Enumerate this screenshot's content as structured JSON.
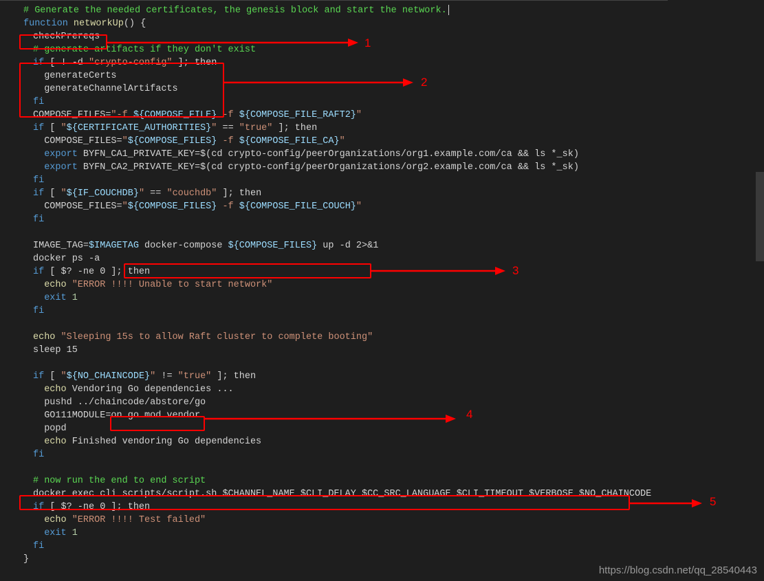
{
  "code": {
    "l1": "# Generate the needed certificates, the genesis block and start the network.",
    "l2_fn": "function",
    "l2_name": " networkUp",
    "l2_rest": "() {",
    "l3": "checkPrereqs",
    "l4": "# generate artifacts if they don't exist",
    "l5_if": "if",
    "l5_cond": " [ ! -d ",
    "l5_str": "\"crypto-config\"",
    "l5_then": " ]; then",
    "l6": "generateCerts",
    "l7": "generateChannelArtifacts",
    "l8": "fi",
    "l9_a": "COMPOSE_FILES=",
    "l9_b": "\"-f ",
    "l9_c": "${COMPOSE_FILE}",
    "l9_d": " -f ",
    "l9_e": "${COMPOSE_FILE_RAFT2}",
    "l9_f": "\"",
    "l10_if": "if",
    "l10_a": " [ ",
    "l10_b": "\"",
    "l10_c": "${CERTIFICATE_AUTHORITIES}",
    "l10_d": "\"",
    "l10_e": " == ",
    "l10_f": "\"true\"",
    "l10_g": " ]; then",
    "l11_a": "COMPOSE_FILES=",
    "l11_b": "\"",
    "l11_c": "${COMPOSE_FILES}",
    "l11_d": " -f ",
    "l11_e": "${COMPOSE_FILE_CA}",
    "l11_f": "\"",
    "l12_exp": "export",
    "l12_a": " BYFN_CA1_PRIVATE_KEY=$(cd crypto-config/peerOrganizations/org1.example.com/ca && ls *_sk)",
    "l13_exp": "export",
    "l13_a": " BYFN_CA2_PRIVATE_KEY=$(cd crypto-config/peerOrganizations/org2.example.com/ca && ls *_sk)",
    "l14": "fi",
    "l15_if": "if",
    "l15_a": " [ ",
    "l15_b": "\"",
    "l15_c": "${IF_COUCHDB}",
    "l15_d": "\"",
    "l15_e": " == ",
    "l15_f": "\"couchdb\"",
    "l15_g": " ]; then",
    "l16_a": "COMPOSE_FILES=",
    "l16_b": "\"",
    "l16_c": "${COMPOSE_FILES}",
    "l16_d": " -f ",
    "l16_e": "${COMPOSE_FILE_COUCH}",
    "l16_f": "\"",
    "l17": "fi",
    "l18_a": "IMAGE_TAG=",
    "l18_b": "$IMAGETAG",
    "l18_c": " docker-compose ",
    "l18_d": "${COMPOSE_FILES}",
    "l18_e": " up -d 2>&1",
    "l19": "docker ps -a",
    "l20_if": "if",
    "l20_a": " [ $? -ne 0 ]; then",
    "l21_echo": "echo",
    "l21_str": " \"ERROR !!!! Unable to start network\"",
    "l22_exit": "exit",
    "l22_num": " 1",
    "l23": "fi",
    "l24_echo": "echo",
    "l24_str": " \"Sleeping 15s to allow Raft cluster to complete booting\"",
    "l25": "sleep 15",
    "l26_if": "if",
    "l26_a": " [ ",
    "l26_b": "\"",
    "l26_c": "${NO_CHAINCODE}",
    "l26_d": "\"",
    "l26_e": " != ",
    "l26_f": "\"true\"",
    "l26_g": " ]; then",
    "l27_echo": "echo",
    "l27_a": " Vendoring Go dependencies ...",
    "l28_a": "pushd ../chaincode/abstore/go",
    "l29_a": "GO111MODULE=on go mod vendor",
    "l30_a": "popd",
    "l31_echo": "echo",
    "l31_a": " Finished vendoring Go dependencies",
    "l32": "fi",
    "l33": "# now run the end to end script",
    "l34": "docker exec cli scripts/script.sh $CHANNEL_NAME $CLI_DELAY $CC_SRC_LANGUAGE $CLI_TIMEOUT $VERBOSE $NO_CHAINCODE",
    "l35_if": "if",
    "l35_a": " [ $? -ne 0 ]; then",
    "l36_echo": "echo",
    "l36_str": " \"ERROR !!!! Test failed\"",
    "l37_exit": "exit",
    "l37_num": " 1",
    "l38": "fi",
    "l39": "}"
  },
  "annotations": {
    "n1": "1",
    "n2": "2",
    "n3": "3",
    "n4": "4",
    "n5": "5"
  },
  "watermark": "https://blog.csdn.net/qq_28540443"
}
